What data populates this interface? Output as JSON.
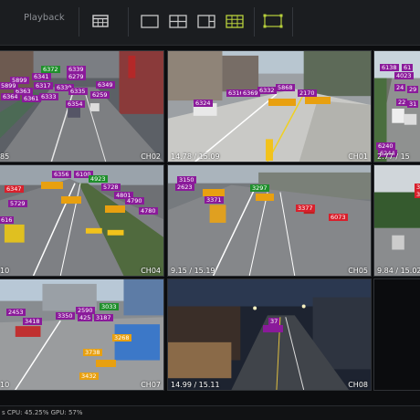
{
  "toolbar": {
    "tabs": [
      {
        "label": ""
      },
      {
        "label": "Playback"
      }
    ]
  },
  "cameras": [
    {
      "label": "CH02",
      "ratio": "85",
      "tags": [
        {
          "text": "6372",
          "c": "g"
        },
        {
          "text": "6339",
          "c": "p"
        },
        {
          "text": "6341",
          "c": "p"
        },
        {
          "text": "5899",
          "c": "p"
        },
        {
          "text": "6279",
          "c": "p"
        },
        {
          "text": "6317",
          "c": "p"
        },
        {
          "text": "6330",
          "c": "p"
        },
        {
          "text": "6335",
          "c": "p"
        },
        {
          "text": "6349",
          "c": "p"
        },
        {
          "text": "6259",
          "c": "p"
        },
        {
          "text": "6363",
          "c": "p"
        },
        {
          "text": "6354",
          "c": "p"
        },
        {
          "text": "6333",
          "c": "p"
        },
        {
          "text": "6364",
          "c": "p"
        },
        {
          "text": "6361",
          "c": "p"
        },
        {
          "text": "5899",
          "c": "p"
        }
      ]
    },
    {
      "label": "CH01",
      "ratio": "14.78 / 15.09",
      "tags": [
        {
          "text": "6316",
          "c": "p"
        },
        {
          "text": "6369",
          "c": "p"
        },
        {
          "text": "6332",
          "c": "p"
        },
        {
          "text": "5868",
          "c": "p"
        },
        {
          "text": "2170",
          "c": "p"
        },
        {
          "text": "6324",
          "c": "p"
        },
        {
          "text": "",
          "c": "o"
        },
        {
          "text": "",
          "c": "o"
        }
      ]
    },
    {
      "label": "",
      "ratio": "2.77 / 15",
      "tags": [
        {
          "text": "6138",
          "c": "p"
        },
        {
          "text": "61",
          "c": "p"
        },
        {
          "text": "4023",
          "c": "p"
        },
        {
          "text": "24",
          "c": "p"
        },
        {
          "text": "29",
          "c": "p"
        },
        {
          "text": "22",
          "c": "p"
        },
        {
          "text": "31",
          "c": "p"
        },
        {
          "text": "6240",
          "c": "p"
        },
        {
          "text": "6244",
          "c": "p"
        }
      ]
    },
    {
      "label": "CH04",
      "ratio": "10",
      "tags": [
        {
          "text": "6356",
          "c": "p"
        },
        {
          "text": "6100",
          "c": "p"
        },
        {
          "text": "4923",
          "c": "g"
        },
        {
          "text": "6347",
          "c": "r"
        },
        {
          "text": "5728",
          "c": "p"
        },
        {
          "text": "4801",
          "c": "p"
        },
        {
          "text": "4790",
          "c": "p"
        },
        {
          "text": "5729",
          "c": "p"
        },
        {
          "text": "4780",
          "c": "p"
        },
        {
          "text": "616",
          "c": "p"
        },
        {
          "text": "",
          "c": "o"
        },
        {
          "text": "",
          "c": "o"
        },
        {
          "text": "",
          "c": "o"
        }
      ]
    },
    {
      "label": "CH05",
      "ratio": "9.15 / 15.19",
      "tags": [
        {
          "text": "3150",
          "c": "p"
        },
        {
          "text": "2623",
          "c": "p"
        },
        {
          "text": "3297",
          "c": "g"
        },
        {
          "text": "3371",
          "c": "p"
        },
        {
          "text": "3377",
          "c": "r"
        },
        {
          "text": "6073",
          "c": "r"
        },
        {
          "text": "",
          "c": "o"
        },
        {
          "text": "",
          "c": "o"
        }
      ]
    },
    {
      "label": "",
      "ratio": "9.84 / 15.02",
      "tags": [
        {
          "text": "32",
          "c": "r"
        },
        {
          "text": "31",
          "c": "r"
        }
      ]
    },
    {
      "label": "CH07",
      "ratio": "10",
      "tags": [
        {
          "text": "2453",
          "c": "p"
        },
        {
          "text": "3033",
          "c": "g"
        },
        {
          "text": "2590",
          "c": "p"
        },
        {
          "text": "3350",
          "c": "p"
        },
        {
          "text": "425",
          "c": "p"
        },
        {
          "text": "3187",
          "c": "p"
        },
        {
          "text": "3418",
          "c": "p"
        },
        {
          "text": "3268",
          "c": "o"
        },
        {
          "text": "3738",
          "c": "o"
        },
        {
          "text": "3432",
          "c": "o"
        },
        {
          "text": "",
          "c": "o"
        }
      ]
    },
    {
      "label": "CH08",
      "ratio": "14.99 / 15.11",
      "tags": [
        {
          "text": "37",
          "c": "p"
        },
        {
          "text": "",
          "c": "p"
        }
      ]
    },
    {
      "label": "",
      "ratio": "",
      "tags": []
    }
  ],
  "status": {
    "text": "s CPU: 45.25% GPU: 57%"
  }
}
